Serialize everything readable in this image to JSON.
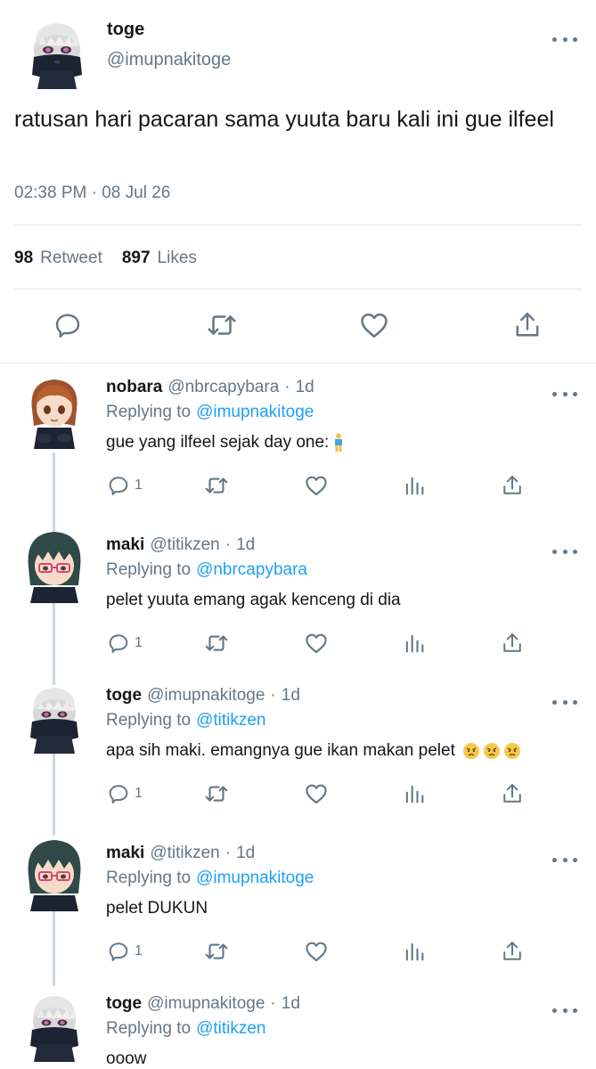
{
  "main_tweet": {
    "name": "toge",
    "handle": "@imupnakitoge",
    "text": "ratusan hari pacaran sama yuuta baru kali ini gue ilfeel",
    "timestamp": "02:38 PM · 08 Jul 26",
    "retweet_count": "98",
    "retweet_label": "Retweet",
    "likes_count": "897",
    "likes_label": "Likes",
    "actions": [
      "reply-icon",
      "retweet-icon",
      "like-icon",
      "share-icon"
    ]
  },
  "replying_label": "Replying to",
  "dot": "·",
  "replies": [
    {
      "name": "nobara",
      "handle": "@nbrcapybara",
      "time": "1d",
      "replying_to": "@imupnakitoge",
      "text": "gue yang ilfeel sejak day one:",
      "emojis": [
        "person-standing-emoji"
      ],
      "reply_count": "1"
    },
    {
      "name": "maki",
      "handle": "@titikzen",
      "time": "1d",
      "replying_to": "@nbrcapybara",
      "text": "pelet yuuta emang agak kenceng di dia",
      "emojis": [],
      "reply_count": "1"
    },
    {
      "name": "toge",
      "handle": "@imupnakitoge",
      "time": "1d",
      "replying_to": "@titikzen",
      "text": "apa sih maki. emangnya gue ikan makan pelet",
      "emojis": [
        "angry-face-emoji",
        "angry-face-emoji",
        "angry-face-emoji"
      ],
      "reply_count": "1"
    },
    {
      "name": "maki",
      "handle": "@titikzen",
      "time": "1d",
      "replying_to": "@imupnakitoge",
      "text": "pelet DUKUN",
      "emojis": [],
      "reply_count": "1"
    },
    {
      "name": "toge",
      "handle": "@imupnakitoge",
      "time": "1d",
      "replying_to": "@titikzen",
      "text": "ooow",
      "emojis": [],
      "reply_count": ""
    }
  ],
  "colors": {
    "text": "#14171a",
    "secondary": "#657786",
    "link": "#1da1f2",
    "divider": "#e1e8ed"
  }
}
